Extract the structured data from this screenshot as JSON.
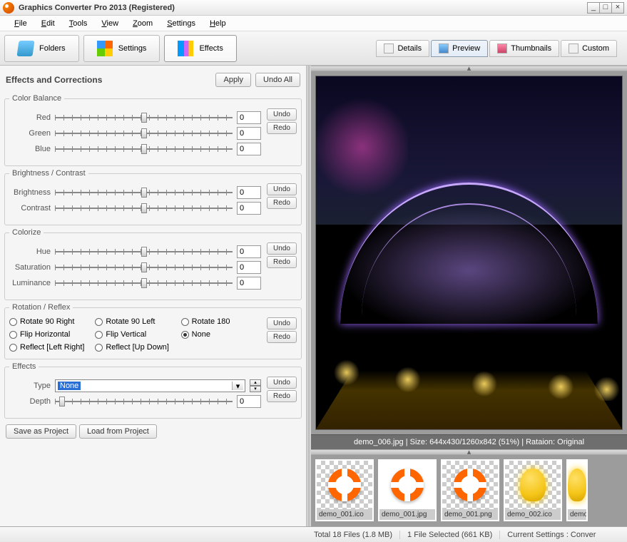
{
  "title": "Graphics Converter Pro 2013  (Registered)",
  "menu": [
    "File",
    "Edit",
    "Tools",
    "View",
    "Zoom",
    "Settings",
    "Help"
  ],
  "tabs": {
    "folders": "Folders",
    "settings": "Settings",
    "effects": "Effects"
  },
  "rtabs": {
    "details": "Details",
    "preview": "Preview",
    "thumbnails": "Thumbnails",
    "custom": "Custom"
  },
  "panel": {
    "title": "Effects and Corrections",
    "apply": "Apply",
    "undoall": "Undo All"
  },
  "btns": {
    "undo": "Undo",
    "redo": "Redo"
  },
  "color": {
    "legend": "Color Balance",
    "red": "Red",
    "green": "Green",
    "blue": "Blue",
    "rv": "0",
    "gv": "0",
    "bv": "0"
  },
  "bc": {
    "legend": "Brightness / Contrast",
    "brightness": "Brightness",
    "contrast": "Contrast",
    "bv": "0",
    "cv": "0"
  },
  "cz": {
    "legend": "Colorize",
    "hue": "Hue",
    "sat": "Saturation",
    "lum": "Luminance",
    "hv": "0",
    "sv": "0",
    "lv": "0"
  },
  "rot": {
    "legend": "Rotation / Reflex",
    "r90r": "Rotate 90 Right",
    "r90l": "Rotate 90 Left",
    "r180": "Rotate 180",
    "fh": "Flip Horizontal",
    "fv": "Flip Vertical",
    "none": "None",
    "rlr": "Reflect [Left Right]",
    "rud": "Reflect [Up Down]"
  },
  "fx": {
    "legend": "Effects",
    "type": "Type",
    "depth": "Depth",
    "typeval": "None",
    "dv": "0"
  },
  "save": "Save as Project",
  "load": "Load from Project",
  "caption": "demo_006.jpg  |  Size:  644x430/1260x842 (51%)  |  Rataion: Original",
  "thumbs": [
    "demo_001.ico",
    "demo_001.jpg",
    "demo_001.png",
    "demo_002.ico",
    "demo_"
  ],
  "status": {
    "left": "",
    "total": "Total 18 Files (1.8 MB)",
    "sel": "1 File Selected (661 KB)",
    "set": "Current Settings : Conver"
  }
}
